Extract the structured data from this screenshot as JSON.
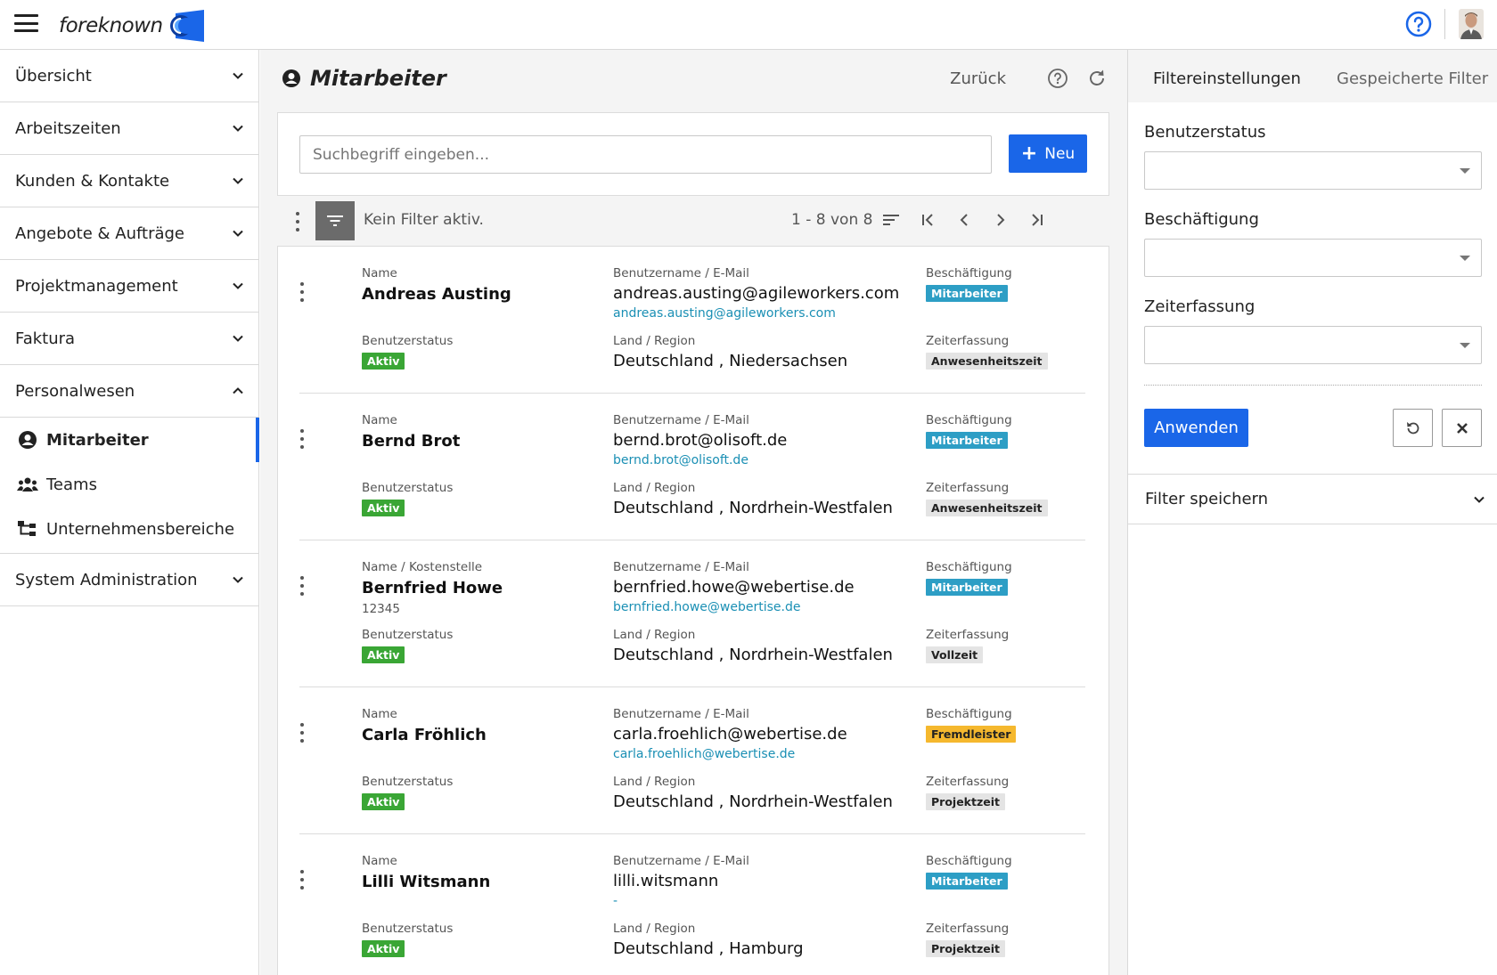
{
  "app": {
    "logo_text": "foreknown",
    "brand_color": "#1a66e8"
  },
  "sidebar": {
    "items": [
      {
        "label": "Übersicht",
        "expanded": false
      },
      {
        "label": "Arbeitszeiten",
        "expanded": false
      },
      {
        "label": "Kunden & Kontakte",
        "expanded": false
      },
      {
        "label": "Angebote & Aufträge",
        "expanded": false
      },
      {
        "label": "Projektmanagement",
        "expanded": false
      },
      {
        "label": "Faktura",
        "expanded": false
      },
      {
        "label": "Personalwesen",
        "expanded": true
      },
      {
        "label": "System Administration",
        "expanded": false
      }
    ],
    "sub_items": [
      {
        "label": "Mitarbeiter",
        "icon": "user-circle-icon",
        "active": true
      },
      {
        "label": "Teams",
        "icon": "people-icon",
        "active": false
      },
      {
        "label": "Unternehmensbereiche",
        "icon": "org-chart-icon",
        "active": false
      }
    ]
  },
  "main": {
    "title": "Mitarbeiter",
    "back_label": "Zurück",
    "search": {
      "placeholder": "Suchbegriff eingeben...",
      "value": ""
    },
    "new_button": "Neu",
    "filter_status": "Kein Filter aktiv.",
    "pager": "1 - 8 von 8",
    "employees": [
      {
        "name_label": "Name",
        "name": "Andreas Austing",
        "cost_center": "",
        "status_label": "Benutzerstatus",
        "status": "Aktiv",
        "user_label": "Benutzername / E-Mail",
        "username": "andreas.austing@agileworkers.com",
        "email": "andreas.austing@agileworkers.com",
        "region_label": "Land / Region",
        "region": "Deutschland , Niedersachsen",
        "employment_label": "Beschäftigung",
        "employment": "Mitarbeiter",
        "employment_color": "#2d9ec5",
        "time_label": "Zeiterfassung",
        "time_tracking": "Anwesenheitszeit"
      },
      {
        "name_label": "Name",
        "name": "Bernd Brot",
        "cost_center": "",
        "status_label": "Benutzerstatus",
        "status": "Aktiv",
        "user_label": "Benutzername / E-Mail",
        "username": "bernd.brot@olisoft.de",
        "email": "bernd.brot@olisoft.de",
        "region_label": "Land / Region",
        "region": "Deutschland , Nordrhein-Westfalen",
        "employment_label": "Beschäftigung",
        "employment": "Mitarbeiter",
        "employment_color": "#2d9ec5",
        "time_label": "Zeiterfassung",
        "time_tracking": "Anwesenheitszeit"
      },
      {
        "name_label": "Name / Kostenstelle",
        "name": "Bernfried Howe",
        "cost_center": "12345",
        "status_label": "Benutzerstatus",
        "status": "Aktiv",
        "user_label": "Benutzername / E-Mail",
        "username": "bernfried.howe@webertise.de",
        "email": "bernfried.howe@webertise.de",
        "region_label": "Land / Region",
        "region": "Deutschland , Nordrhein-Westfalen",
        "employment_label": "Beschäftigung",
        "employment": "Mitarbeiter",
        "employment_color": "#2d9ec5",
        "time_label": "Zeiterfassung",
        "time_tracking": "Vollzeit"
      },
      {
        "name_label": "Name",
        "name": "Carla Fröhlich",
        "cost_center": "",
        "status_label": "Benutzerstatus",
        "status": "Aktiv",
        "user_label": "Benutzername / E-Mail",
        "username": "carla.froehlich@webertise.de",
        "email": "carla.froehlich@webertise.de",
        "region_label": "Land / Region",
        "region": "Deutschland , Nordrhein-Westfalen",
        "employment_label": "Beschäftigung",
        "employment": "Fremdleister",
        "employment_color": "#f5b82e",
        "time_label": "Zeiterfassung",
        "time_tracking": "Projektzeit"
      },
      {
        "name_label": "Name",
        "name": "Lilli Witsmann",
        "cost_center": "",
        "status_label": "Benutzerstatus",
        "status": "Aktiv",
        "user_label": "Benutzername / E-Mail",
        "username": "lilli.witsmann",
        "email": "-",
        "region_label": "Land / Region",
        "region": "Deutschland , Hamburg",
        "employment_label": "Beschäftigung",
        "employment": "Mitarbeiter",
        "employment_color": "#2d9ec5",
        "time_label": "Zeiterfassung",
        "time_tracking": "Projektzeit"
      }
    ]
  },
  "filter_panel": {
    "tab_settings": "Filtereinstellungen",
    "tab_saved": "Gespeicherte Filter",
    "user_status_label": "Benutzerstatus",
    "employment_label": "Beschäftigung",
    "time_tracking_label": "Zeiterfassung",
    "apply_label": "Anwenden",
    "save_filter_label": "Filter speichern"
  }
}
